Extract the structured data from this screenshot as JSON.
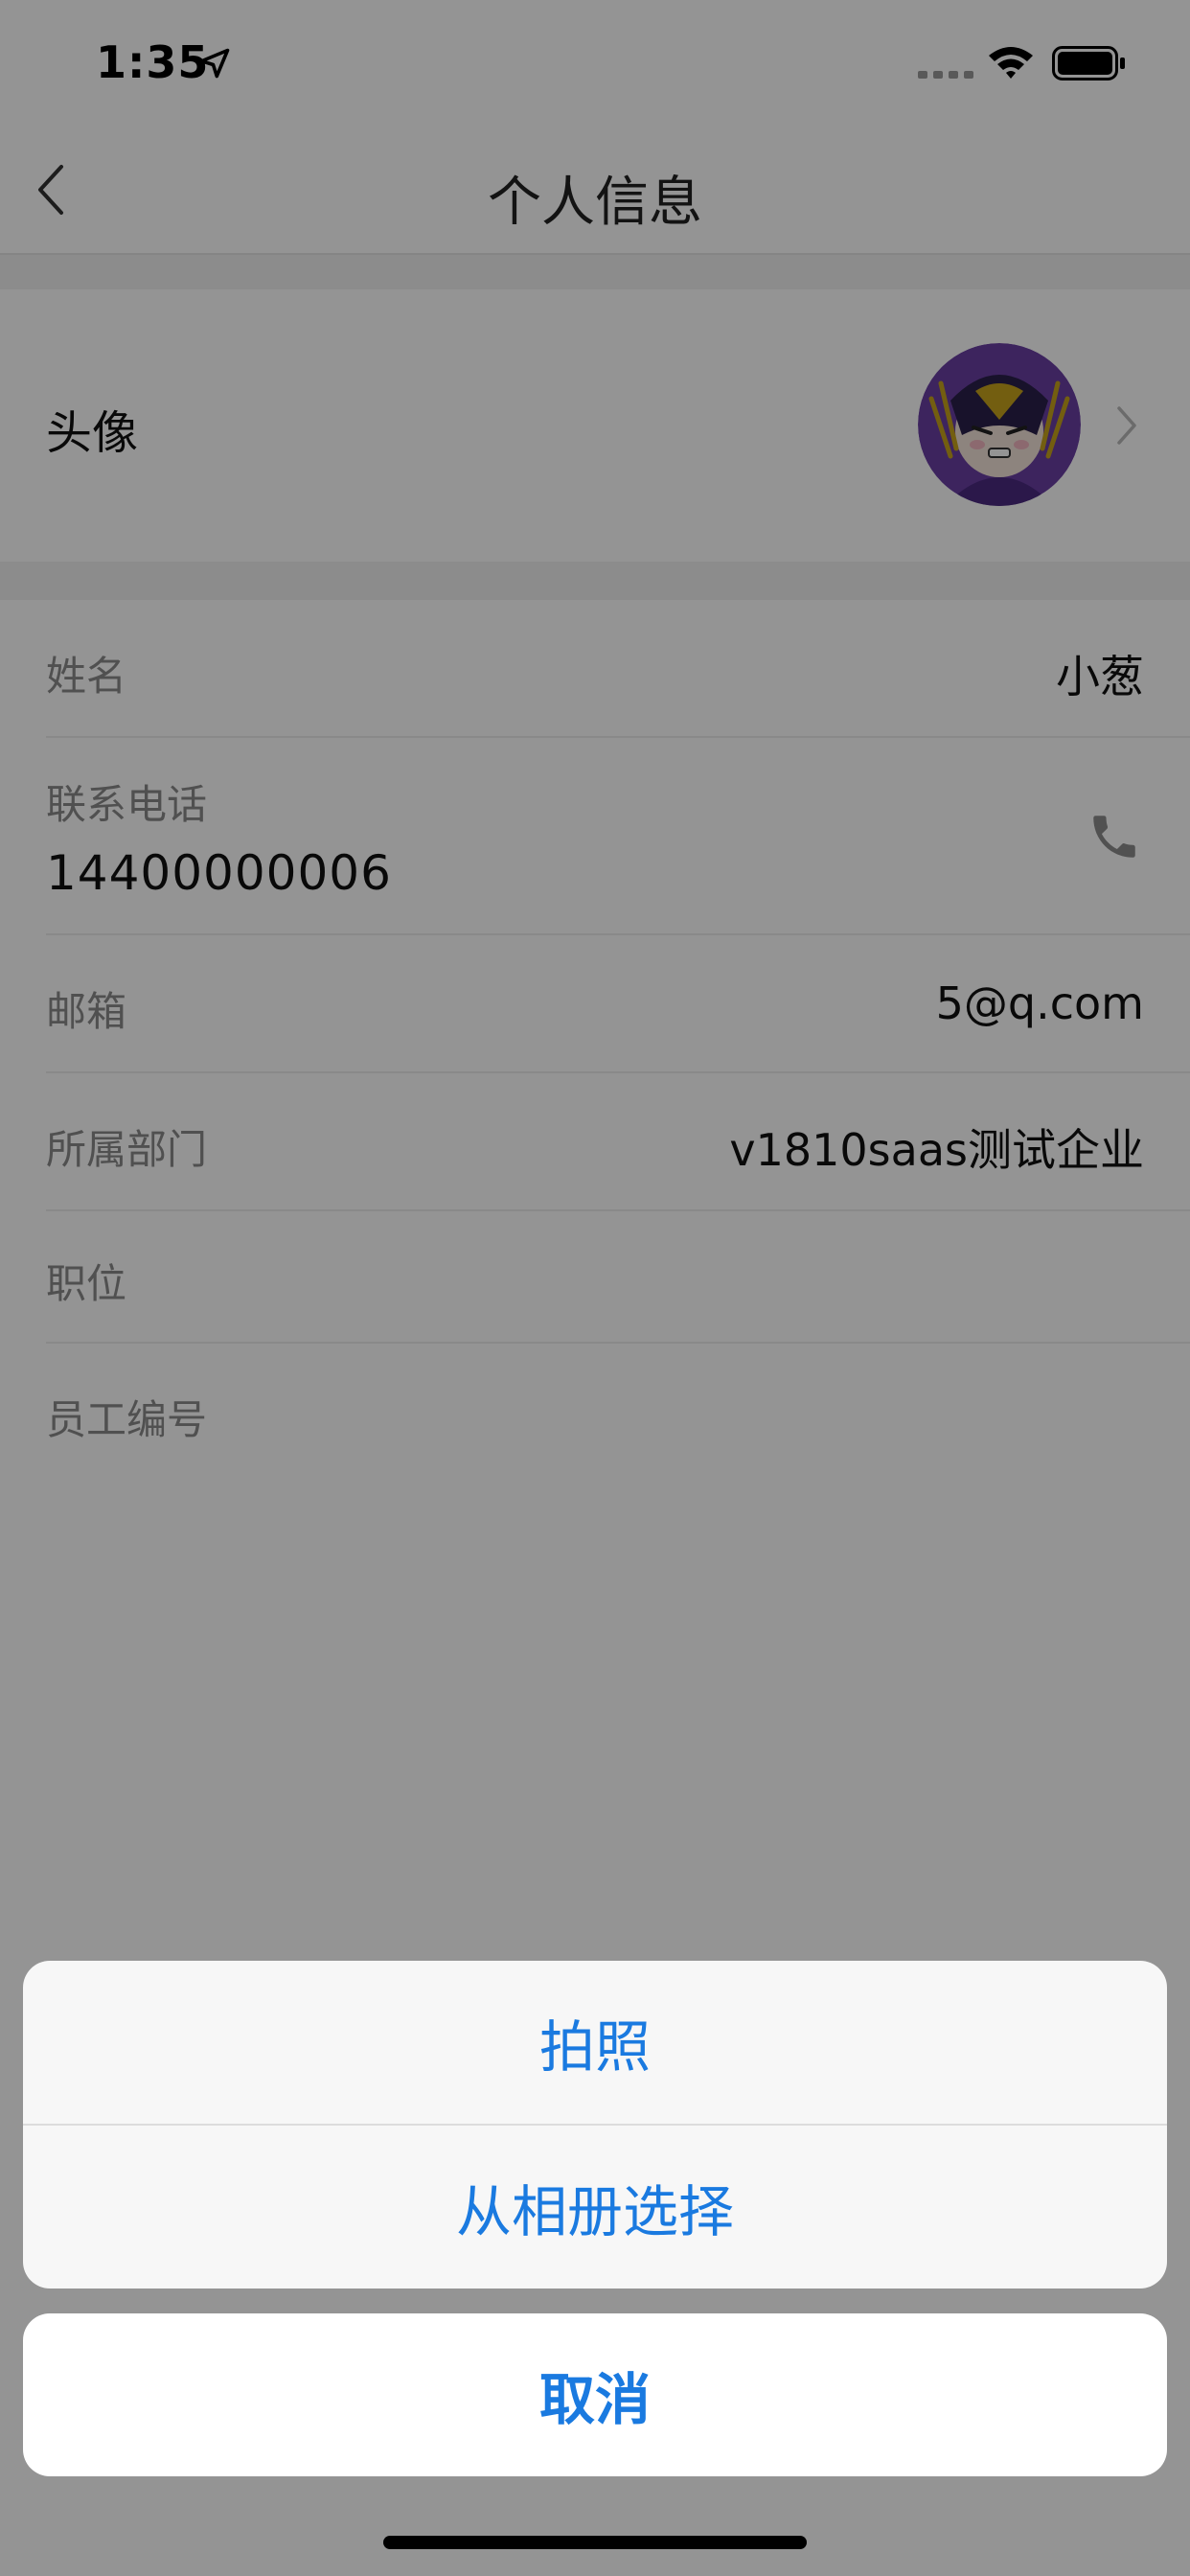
{
  "status_bar": {
    "time": "1:35"
  },
  "nav": {
    "title": "个人信息"
  },
  "avatar_row": {
    "label": "头像"
  },
  "info": {
    "name": {
      "label": "姓名",
      "value": "小葱"
    },
    "phone": {
      "label": "联系电话",
      "value": "14400000006"
    },
    "email": {
      "label": "邮箱",
      "value": "5@q.com"
    },
    "department": {
      "label": "所属部门",
      "value": "v1810saas测试企业"
    },
    "position": {
      "label": "职位",
      "value": ""
    },
    "employee_id": {
      "label": "员工编号",
      "value": ""
    }
  },
  "action_sheet": {
    "take_photo": "拍照",
    "choose_from_album": "从相册选择",
    "cancel": "取消"
  },
  "colors": {
    "accent": "#1a7ae0",
    "overlay": "rgba(0,0,0,0.42)"
  },
  "icons": [
    "location-arrow-icon",
    "signal-dots-icon",
    "wifi-icon",
    "battery-icon",
    "back-chevron-icon",
    "right-chevron-icon",
    "phone-icon"
  ]
}
